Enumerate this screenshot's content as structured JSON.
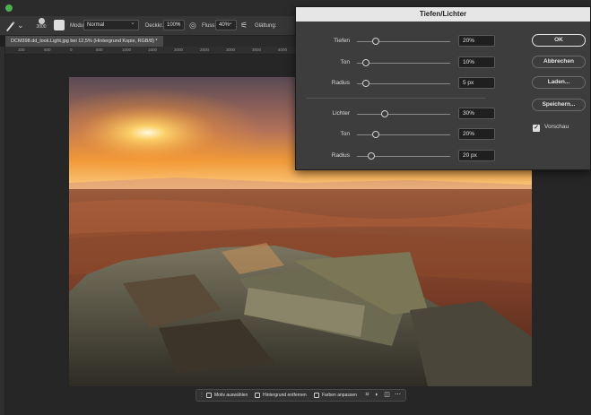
{
  "options_bar": {
    "brush_size": "3000",
    "mode_label": "Modus:",
    "mode_value": "Normal",
    "opacity_label": "Deckkr.:",
    "opacity_value": "100%",
    "flow_label": "Fluss:",
    "flow_value": "40%",
    "smoothing_label": "Glättung:"
  },
  "document_tab": {
    "title": "DCM398.dd_look.Light.jpg bei 12,5% (Hintergrund Kopie, RGB/8) *"
  },
  "ruler": {
    "ticks": [
      "100",
      "500",
      "0",
      "500",
      "1000",
      "1500",
      "2000",
      "2500",
      "3000",
      "3500",
      "4000"
    ]
  },
  "dialog": {
    "title": "Tiefen/Lichter",
    "shadows": [
      {
        "label": "Tiefen",
        "value": "20%",
        "slider": 0.2
      },
      {
        "label": "Ton",
        "value": "10%",
        "slider": 0.1
      },
      {
        "label": "Radius",
        "value": "5 px",
        "slider": 0.1
      }
    ],
    "highlights": [
      {
        "label": "Lichter",
        "value": "30%",
        "slider": 0.3
      },
      {
        "label": "Ton",
        "value": "20%",
        "slider": 0.2
      },
      {
        "label": "Radius",
        "value": "20 px",
        "slider": 0.15
      }
    ],
    "buttons": {
      "ok": "OK",
      "cancel": "Abbrechen",
      "load": "Laden...",
      "save": "Speichern..."
    },
    "preview_label": "Vorschau",
    "preview_checked": true
  },
  "taskbar": {
    "select_subject": "Motiv auswählen",
    "remove_background": "Hintergrund entfernen",
    "adjust_colors": "Farben anpassen"
  },
  "colors": {
    "app_bg": "#1f1f1f",
    "panel": "#3d3d3d",
    "title_bar": "#e6e6e6",
    "accent_green": "#4caf50"
  }
}
